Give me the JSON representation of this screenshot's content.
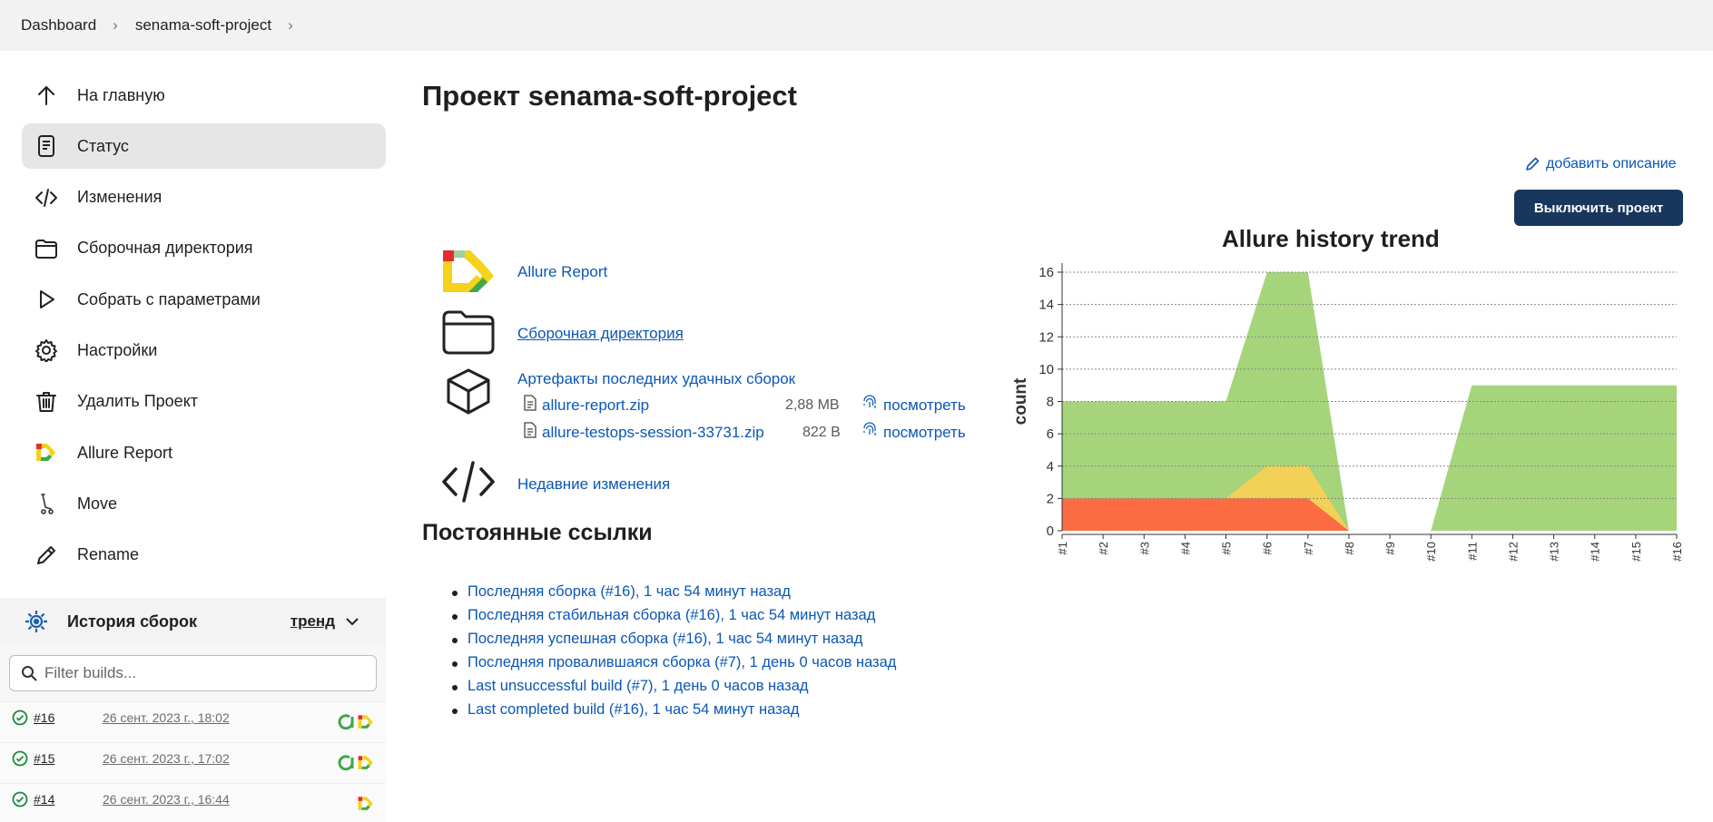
{
  "breadcrumb": [
    "Dashboard",
    "senama-soft-project"
  ],
  "sidebar": {
    "items": [
      {
        "label": "На главную",
        "icon": "arrow-up-icon"
      },
      {
        "label": "Статус",
        "icon": "document-icon",
        "active": true
      },
      {
        "label": "Изменения",
        "icon": "code-icon"
      },
      {
        "label": "Сборочная директория",
        "icon": "folder-icon"
      },
      {
        "label": "Собрать с параметрами",
        "icon": "play-icon"
      },
      {
        "label": "Настройки",
        "icon": "gear-icon"
      },
      {
        "label": "Удалить Проект",
        "icon": "trash-icon"
      },
      {
        "label": "Allure Report",
        "icon": "allure-icon"
      },
      {
        "label": "Move",
        "icon": "move-icon"
      },
      {
        "label": "Rename",
        "icon": "pencil-icon"
      }
    ]
  },
  "history": {
    "title": "История сборок",
    "trend_label": "тренд",
    "filter_placeholder": "Filter builds...",
    "builds": [
      {
        "number": "#16",
        "date": "26 сент. 2023 г., 18:02"
      },
      {
        "number": "#15",
        "date": "26 сент. 2023 г., 17:02"
      },
      {
        "number": "#14",
        "date": "26 сент. 2023 г., 16:44"
      }
    ]
  },
  "main": {
    "title": "Проект senama-soft-project",
    "add_description": "добавить описание",
    "disable_button": "Выключить проект",
    "links": {
      "allure": "Allure Report",
      "workspace": "Сборочная директория",
      "artifacts": "Артефакты последних удачных сборок",
      "recent_changes": "Недавние изменения"
    },
    "artifacts": [
      {
        "file": "allure-report.zip",
        "size": "2,88 MB",
        "view": "посмотреть"
      },
      {
        "file": "allure-testops-session-33731.zip",
        "size": "822 B",
        "view": "посмотреть"
      }
    ],
    "permalinks_title": "Постоянные ссылки",
    "permalinks": [
      "Последняя сборка (#16), 1 час 54 минут назад",
      "Последняя стабильная сборка (#16), 1 час 54 минут назад",
      "Последняя успешная сборка (#16), 1 час 54 минут назад",
      "Последняя провалившаяся сборка (#7), 1 день 0 часов назад",
      "Last unsuccessful build (#7), 1 день 0 часов назад",
      "Last completed build (#16), 1 час 54 минут назад"
    ]
  },
  "colors": {
    "accent": "#0b57b5",
    "button_bg": "#19365c",
    "passed": "#97cc64",
    "broken": "#ffd050",
    "failed": "#fd5a3e"
  },
  "chart_data": {
    "type": "area",
    "title": "Allure history trend",
    "ylabel": "count",
    "xlabel": "",
    "ylim": [
      0,
      16
    ],
    "yticks": [
      0,
      2,
      4,
      6,
      8,
      10,
      12,
      14,
      16
    ],
    "categories": [
      "#1",
      "#2",
      "#3",
      "#4",
      "#5",
      "#6",
      "#7",
      "#8",
      "#9",
      "#10",
      "#11",
      "#12",
      "#13",
      "#14",
      "#15",
      "#16"
    ],
    "series": [
      {
        "values": [
          2,
          2,
          2,
          2,
          2,
          2,
          2,
          0,
          null,
          0,
          0,
          0,
          0,
          0,
          0,
          0
        ],
        "color": "#fd5a3e"
      },
      {
        "values": [
          0,
          0,
          0,
          0,
          0,
          2,
          2,
          0,
          null,
          0,
          0,
          0,
          0,
          0,
          0,
          0
        ],
        "color": "#ffd050"
      },
      {
        "values": [
          6,
          6,
          6,
          6,
          6,
          12,
          12,
          0,
          null,
          0,
          9,
          9,
          9,
          9,
          9,
          9
        ],
        "color": "#97cc64"
      }
    ],
    "grid": true
  }
}
